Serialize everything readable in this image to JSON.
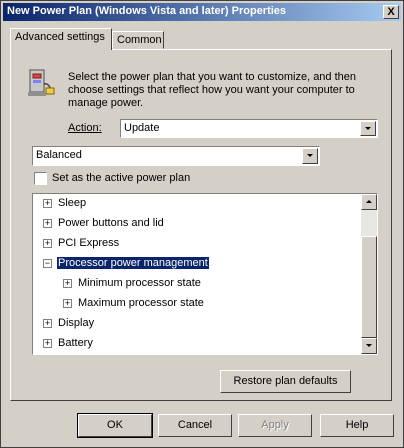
{
  "window": {
    "title": "New Power Plan (Windows Vista and later) Properties",
    "close_glyph": "X"
  },
  "tabs": [
    {
      "label": "Advanced settings",
      "active": true
    },
    {
      "label": "Common",
      "active": false
    }
  ],
  "description": "Select the power plan that you want to customize, and then choose settings that reflect how you want your computer to manage power.",
  "action": {
    "label": "Action:",
    "value": "Update"
  },
  "plan": {
    "value": "Balanced"
  },
  "active_plan": {
    "label": "Set as the active power plan",
    "checked": false
  },
  "tree": {
    "items": [
      {
        "label": "Sleep",
        "expander": "+"
      },
      {
        "label": "Power buttons and lid",
        "expander": "+"
      },
      {
        "label": "PCI Express",
        "expander": "+"
      },
      {
        "label": "Processor power management",
        "expander": "−"
      },
      {
        "label": "Minimum processor state",
        "expander": "+"
      },
      {
        "label": "Maximum processor state",
        "expander": "+"
      },
      {
        "label": "Display",
        "expander": "+"
      },
      {
        "label": "Battery",
        "expander": "+"
      }
    ]
  },
  "buttons": {
    "restore": "Restore plan defaults",
    "ok": "OK",
    "cancel": "Cancel",
    "apply": "Apply",
    "help": "Help"
  }
}
